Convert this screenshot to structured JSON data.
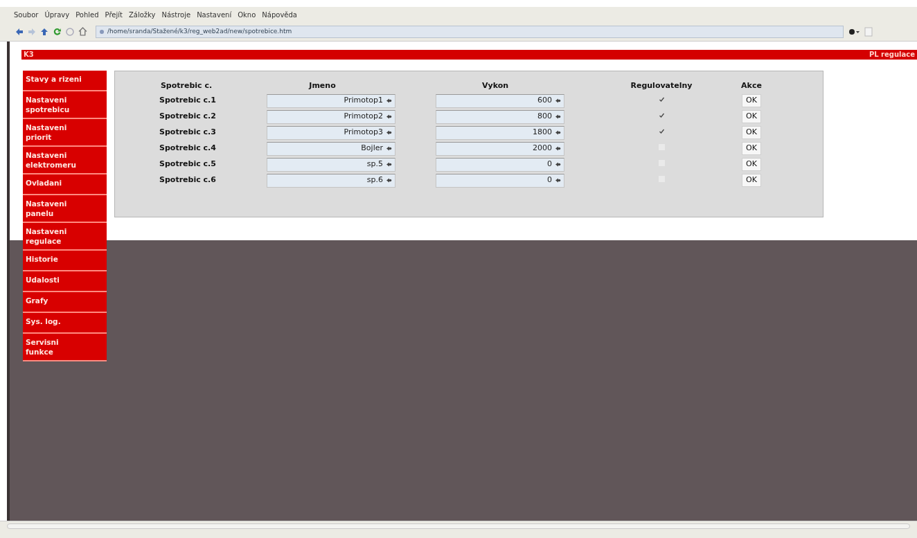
{
  "menu_bar": [
    "Soubor",
    "Úpravy",
    "Pohled",
    "Přejít",
    "Záložky",
    "Nástroje",
    "Nastavení",
    "Okno",
    "Nápověda"
  ],
  "address_bar": {
    "value": "/home/sranda/Stažené/k3/reg_web2ad/new/spotrebice.htm"
  },
  "header": {
    "left": "K3",
    "right": "PL regulace"
  },
  "sidebar": {
    "items": [
      {
        "label": "Stavy a rizeni"
      },
      {
        "label": "Nastaveni spotrebicu"
      },
      {
        "label": "Nastaveni priorit"
      },
      {
        "label": "Nastaveni elektromeru"
      },
      {
        "label": "Ovladani"
      },
      {
        "label": "Nastaveni panelu"
      },
      {
        "label": "Nastaveni regulace"
      },
      {
        "label": "Historie"
      },
      {
        "label": "Udalosti"
      },
      {
        "label": "Grafy"
      },
      {
        "label": "Sys. log."
      },
      {
        "label": "Servisni funkce"
      }
    ]
  },
  "table": {
    "columns": [
      "Spotrebic c.",
      "Jmeno",
      "Vykon",
      "Regulovatelny",
      "Akce"
    ],
    "rows": [
      {
        "label": "Spotrebic c.1",
        "name": "Primotop1",
        "power": "600",
        "checked": true,
        "action": "OK"
      },
      {
        "label": "Spotrebic c.2",
        "name": "Primotop2",
        "power": "800",
        "checked": true,
        "action": "OK"
      },
      {
        "label": "Spotrebic c.3",
        "name": "Primotop3",
        "power": "1800",
        "checked": true,
        "action": "OK"
      },
      {
        "label": "Spotrebic c.4",
        "name": "Bojler",
        "power": "2000",
        "checked": false,
        "action": "OK"
      },
      {
        "label": "Spotrebic c.5",
        "name": "sp.5",
        "power": "0",
        "checked": false,
        "action": "OK"
      },
      {
        "label": "Spotrebic c.6",
        "name": "sp.6",
        "power": "0",
        "checked": false,
        "action": "OK"
      }
    ]
  }
}
